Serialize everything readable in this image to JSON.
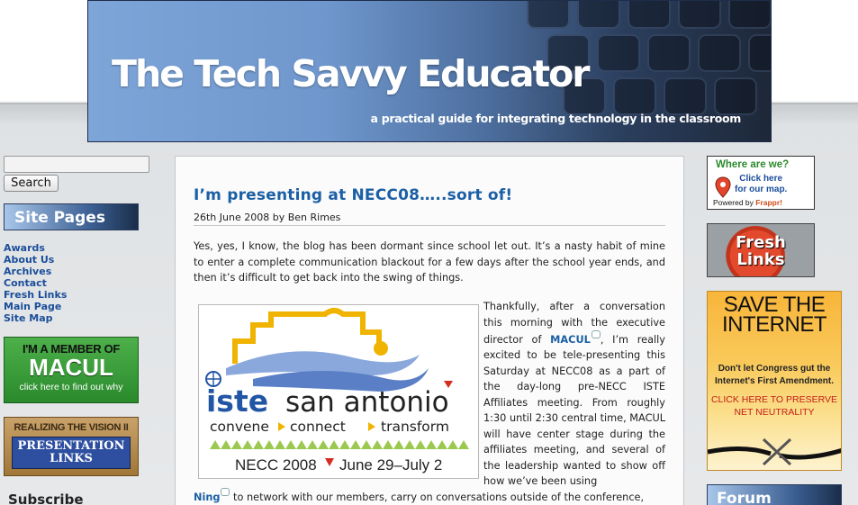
{
  "header": {
    "title": "The Tech Savvy Educator",
    "tagline": "a practical guide for integrating technology in the classroom"
  },
  "search": {
    "placeholder": "",
    "button_label": "Search"
  },
  "sidebar": {
    "site_pages_heading": "Site Pages",
    "links": [
      "Awards",
      "About Us",
      "Archives",
      "Contact",
      "Fresh Links",
      "Main Page",
      "Site Map"
    ],
    "macul_ad": {
      "line1": "I'M A MEMBER OF",
      "line2": "MACUL",
      "line3": "click here to find out why"
    },
    "vision_ad": {
      "line1": "REALIZING THE VISION II",
      "line2": "PRESENTATION",
      "line3": "LINKS"
    },
    "subscribe_heading": "Subscribe"
  },
  "post": {
    "title": "I’m presenting at NECC08…..sort of!",
    "meta": "26th June 2008 by Ben Rimes",
    "para1": "Yes, yes, I know, the blog has been dormant since school let out. It’s a nasty habit of mine to enter a complete communication blackout for a few days after the school year ends, and then it’s difficult to get back into the swing of things.",
    "para2_before": "Thankfully, after a conversation this morning with the executive director of ",
    "para2_link": "MACUL",
    "para2_after": ", I’m really excited to be tele-presenting this Saturday at NECC08 as a part of the day-long pre-NECC ISTE Affiliates meeting. From roughly 1:30 until 2:30 central time, MACUL will have center stage during the affiliates meeting, and several of the leadership wanted to show off how we’ve been using",
    "para3_link": "Ning",
    "para3_after": " to network with our members, carry on conversations outside of the conference,",
    "image": {
      "brand_iste": "iste",
      "brand_city": "san antonio",
      "words": [
        "convene",
        "connect",
        "transform"
      ],
      "event": "NECC 2008",
      "dates": "June 29–July 2"
    }
  },
  "right_sidebar": {
    "frappr": {
      "question": "Where are we?",
      "cta_line1": "Click here",
      "cta_line2": "for our map.",
      "powered_prefix": "Powered by ",
      "powered_brand": "Frappr!"
    },
    "fresh_links": {
      "line1": "Fresh",
      "line2": "Links"
    },
    "save_internet": {
      "headline_1": "SAVE THE",
      "headline_2": "INTERNET",
      "body": "Don't let Congress gut the Internet's First Amendment.",
      "cta": "CLICK HERE TO PRESERVE NET NEUTRALITY"
    },
    "forum_heading": "Forum"
  },
  "colors": {
    "link_blue": "#1b5fa5",
    "banner_dark": "#1d2738",
    "macul_green": "#3a9e3a",
    "save_orange": "#f8b53a",
    "iste_blue": "#2255a4",
    "necc_red": "#d72b1f"
  }
}
